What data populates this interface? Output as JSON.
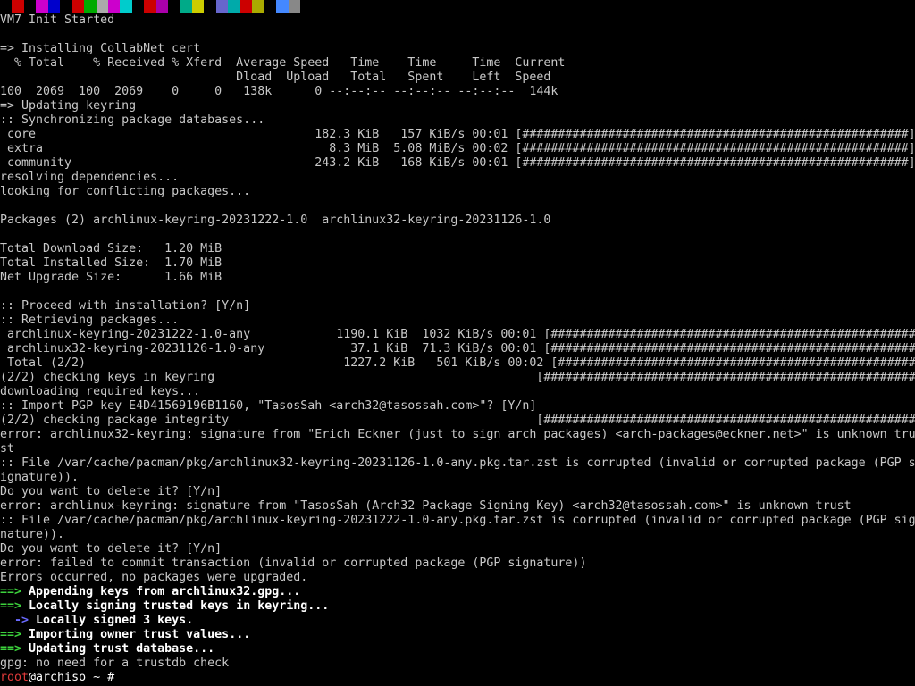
{
  "garbage_colors": [
    "#000000",
    "#cc0000",
    "#000000",
    "#cc00cc",
    "#0000cc",
    "#000000",
    "#cc0000",
    "#00aa00",
    "#aaaaaa",
    "#cc00cc",
    "#00cccc",
    "#000000",
    "#cc0000",
    "#aa00aa",
    "#000000",
    "#00aa88",
    "#cccc00",
    "#000000",
    "#6666cc",
    "#00aaaa",
    "#cc0000",
    "#aaaa00",
    "#000000",
    "#4488ff",
    "#888888"
  ],
  "lines": [
    {
      "t": "VM7 Init Started",
      "s": "plain"
    },
    {
      "t": "",
      "s": "plain"
    },
    {
      "t": "=> Installing CollabNet cert",
      "s": "plain"
    },
    {
      "t": "  % Total    % Received % Xferd  Average Speed   Time    Time     Time  Current",
      "s": "plain"
    },
    {
      "t": "                                 Dload  Upload   Total   Spent    Left  Speed",
      "s": "plain"
    },
    {
      "t": "100  2069  100  2069    0     0   138k      0 --:--:-- --:--:-- --:--:--  144k",
      "s": "plain"
    },
    {
      "t": "=> Updating keyring",
      "s": "plain"
    },
    {
      "t": ":: Synchronizing package databases...",
      "s": "plain"
    },
    {
      "t": " core                                       182.3 KiB   157 KiB/s 00:01 [######################################################] 100%",
      "s": "plain"
    },
    {
      "t": " extra                                        8.3 MiB  5.08 MiB/s 00:02 [######################################################] 100%",
      "s": "plain"
    },
    {
      "t": " community                                  243.2 KiB   168 KiB/s 00:01 [######################################################] 100%",
      "s": "plain"
    },
    {
      "t": "resolving dependencies...",
      "s": "plain"
    },
    {
      "t": "looking for conflicting packages...",
      "s": "plain"
    },
    {
      "t": "",
      "s": "plain"
    },
    {
      "t": "Packages (2) archlinux-keyring-20231222-1.0  archlinux32-keyring-20231126-1.0",
      "s": "plain"
    },
    {
      "t": "",
      "s": "plain"
    },
    {
      "t": "Total Download Size:   1.20 MiB",
      "s": "plain"
    },
    {
      "t": "Total Installed Size:  1.70 MiB",
      "s": "plain"
    },
    {
      "t": "Net Upgrade Size:      1.66 MiB",
      "s": "plain"
    },
    {
      "t": "",
      "s": "plain"
    },
    {
      "t": ":: Proceed with installation? [Y/n]",
      "s": "plain"
    },
    {
      "t": ":: Retrieving packages...",
      "s": "plain"
    },
    {
      "t": " archlinux-keyring-20231222-1.0-any            1190.1 KiB  1032 KiB/s 00:01 [######################################################] 100%",
      "s": "plain"
    },
    {
      "t": " archlinux32-keyring-20231126-1.0-any            37.1 KiB  71.3 KiB/s 00:01 [######################################################] 100%",
      "s": "plain"
    },
    {
      "t": " Total (2/2)                                    1227.2 KiB   501 KiB/s 00:02 [######################################################] 100%",
      "s": "plain"
    },
    {
      "t": "(2/2) checking keys in keyring                                             [######################################################] 100%",
      "s": "plain"
    },
    {
      "t": "downloading required keys...",
      "s": "plain"
    },
    {
      "t": ":: Import PGP key E4D41569196B1160, \"TasosSah <arch32@tasossah.com>\"? [Y/n]",
      "s": "plain"
    },
    {
      "t": "(2/2) checking package integrity                                           [######################################################] 100%",
      "s": "plain"
    },
    {
      "t": "error: archlinux32-keyring: signature from \"Erich Eckner (just to sign arch packages) <arch-packages@eckner.net>\" is unknown tru",
      "s": "plain"
    },
    {
      "t": "st",
      "s": "plain"
    },
    {
      "t": ":: File /var/cache/pacman/pkg/archlinux32-keyring-20231126-1.0-any.pkg.tar.zst is corrupted (invalid or corrupted package (PGP s",
      "s": "plain"
    },
    {
      "t": "ignature)).",
      "s": "plain"
    },
    {
      "t": "Do you want to delete it? [Y/n]",
      "s": "plain"
    },
    {
      "t": "error: archlinux-keyring: signature from \"TasosSah (Arch32 Package Signing Key) <arch32@tasossah.com>\" is unknown trust",
      "s": "plain"
    },
    {
      "t": ":: File /var/cache/pacman/pkg/archlinux-keyring-20231222-1.0-any.pkg.tar.zst is corrupted (invalid or corrupted package (PGP sig",
      "s": "plain"
    },
    {
      "t": "nature)).",
      "s": "plain"
    },
    {
      "t": "Do you want to delete it? [Y/n]",
      "s": "plain"
    },
    {
      "t": "error: failed to commit transaction (invalid or corrupted package (PGP signature))",
      "s": "plain"
    },
    {
      "t": "Errors occurred, no packages were upgraded.",
      "s": "plain"
    },
    {
      "p": "==>",
      "t": " Appending keys from archlinux32.gpg...",
      "s": "green"
    },
    {
      "p": "==>",
      "t": " Locally signing trusted keys in keyring...",
      "s": "green"
    },
    {
      "p": "  ->",
      "t": " Locally signed 3 keys.",
      "s": "blue"
    },
    {
      "p": "==>",
      "t": " Importing owner trust values...",
      "s": "green"
    },
    {
      "p": "==>",
      "t": " Updating trust database...",
      "s": "green"
    },
    {
      "t": "gpg: no need for a trustdb check",
      "s": "plain"
    },
    {
      "user": "root",
      "rest": "@archiso ~ #",
      "s": "prompt"
    }
  ]
}
